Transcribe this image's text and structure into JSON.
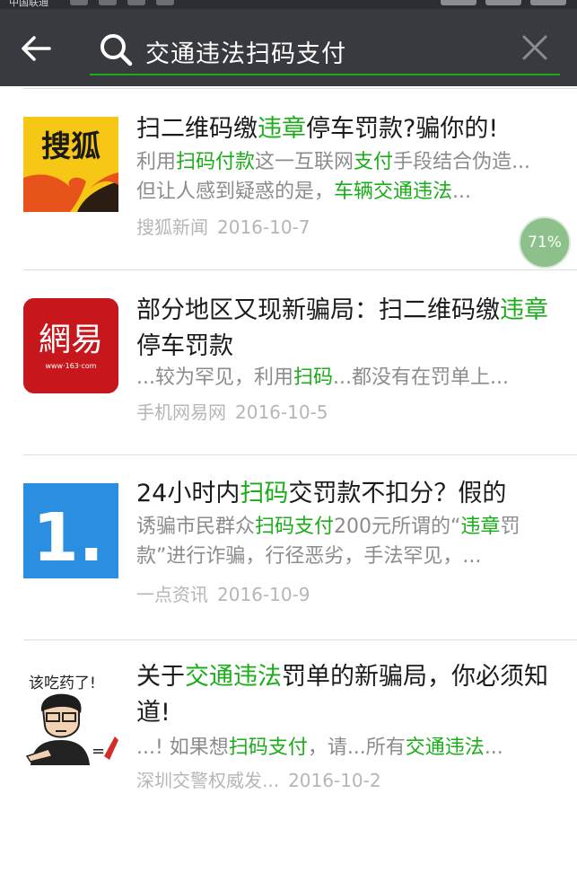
{
  "status_bar": {
    "carrier": "中国联通"
  },
  "header": {
    "search_query": "交通违法扫码支付"
  },
  "results": [
    {
      "logo_text": "搜狐",
      "title": [
        {
          "t": "扫二维码缴"
        },
        {
          "t": "违章",
          "hl": true
        },
        {
          "t": "停车罚款?骗你的!"
        }
      ],
      "desc": [
        {
          "t": "利用"
        },
        {
          "t": "扫码付款",
          "hl": true
        },
        {
          "t": "这一互联网"
        },
        {
          "t": "支付",
          "hl": true
        },
        {
          "t": "手段结合伪造...但让人感到疑惑的是，"
        },
        {
          "t": "车辆交通违法",
          "hl": true
        },
        {
          "t": "..."
        }
      ],
      "source": "搜狐新闻",
      "date": "2016-10-7"
    },
    {
      "logo_text": "網易",
      "logo_sub": "www·163·com",
      "title": [
        {
          "t": "部分地区又现新骗局：扫二维码缴"
        },
        {
          "t": "违章",
          "hl": true
        },
        {
          "t": "停车罚款"
        }
      ],
      "desc": [
        {
          "t": "...较为罕见，利用"
        },
        {
          "t": "扫码",
          "hl": true
        },
        {
          "t": "...都没有在罚单上..."
        }
      ],
      "source": "手机网易网",
      "date": "2016-10-5"
    },
    {
      "logo_text": "1.",
      "title": [
        {
          "t": "24小时内"
        },
        {
          "t": "扫码",
          "hl": true
        },
        {
          "t": "交罚款不扣分？假的"
        }
      ],
      "desc": [
        {
          "t": "诱骗市民群众"
        },
        {
          "t": "扫码支付",
          "hl": true
        },
        {
          "t": "200元所谓的“"
        },
        {
          "t": "违章",
          "hl": true
        },
        {
          "t": "罚款”进行诈骗，行径恶劣，手法罕见，..."
        }
      ],
      "source": "一点资讯",
      "date": "2016-10-9"
    },
    {
      "logo_text": "该吃药了!",
      "title": [
        {
          "t": "关于"
        },
        {
          "t": "交通违法",
          "hl": true
        },
        {
          "t": "罚单的新骗局，你必须知道!"
        }
      ],
      "desc": [
        {
          "t": "...!  如果想"
        },
        {
          "t": "扫码支付",
          "hl": true
        },
        {
          "t": "，请...所有"
        },
        {
          "t": "交通违法",
          "hl": true
        },
        {
          "t": "..."
        }
      ],
      "source": "深圳交警权威发...",
      "date": "2016-10-2"
    }
  ],
  "reading_progress": "71%",
  "colors": {
    "accent": "#1aad19",
    "header_bg": "#393a3f",
    "sohu_yellow": "#f6c714",
    "netease_red": "#c8161d",
    "yidian_blue": "#2a8fe0"
  }
}
